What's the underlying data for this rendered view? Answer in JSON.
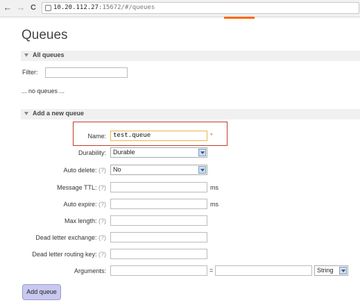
{
  "browser": {
    "url_host": "10.20.112.27",
    "url_rest": ":15672/#/queues",
    "back_glyph": "←",
    "forward_glyph": "→",
    "reload_glyph": "C"
  },
  "page": {
    "title": "Queues"
  },
  "all_queues": {
    "header": "All queues",
    "filter_label": "Filter:",
    "filter_value": "",
    "empty_text": "... no queues ..."
  },
  "add_queue": {
    "header": "Add a new queue",
    "name_label": "Name:",
    "name_value": "test.queue",
    "required_mark": "*",
    "durability_label": "Durability:",
    "durability_value": "Durable",
    "auto_delete_label": "Auto delete:",
    "auto_delete_value": "No",
    "help": "(?)",
    "message_ttl_label": "Message TTL:",
    "message_ttl_unit": "ms",
    "auto_expire_label": "Auto expire:",
    "auto_expire_unit": "ms",
    "max_length_label": "Max length:",
    "dead_letter_exchange_label": "Dead letter exchange:",
    "dead_letter_routing_key_label": "Dead letter routing key:",
    "arguments_label": "Arguments:",
    "arguments_equals": "=",
    "arguments_type_value": "String",
    "submit_label": "Add queue"
  },
  "colors": {
    "accent_orange": "#ff6600",
    "highlight_red": "#c0392b",
    "button_bg": "#c8c8f0"
  }
}
